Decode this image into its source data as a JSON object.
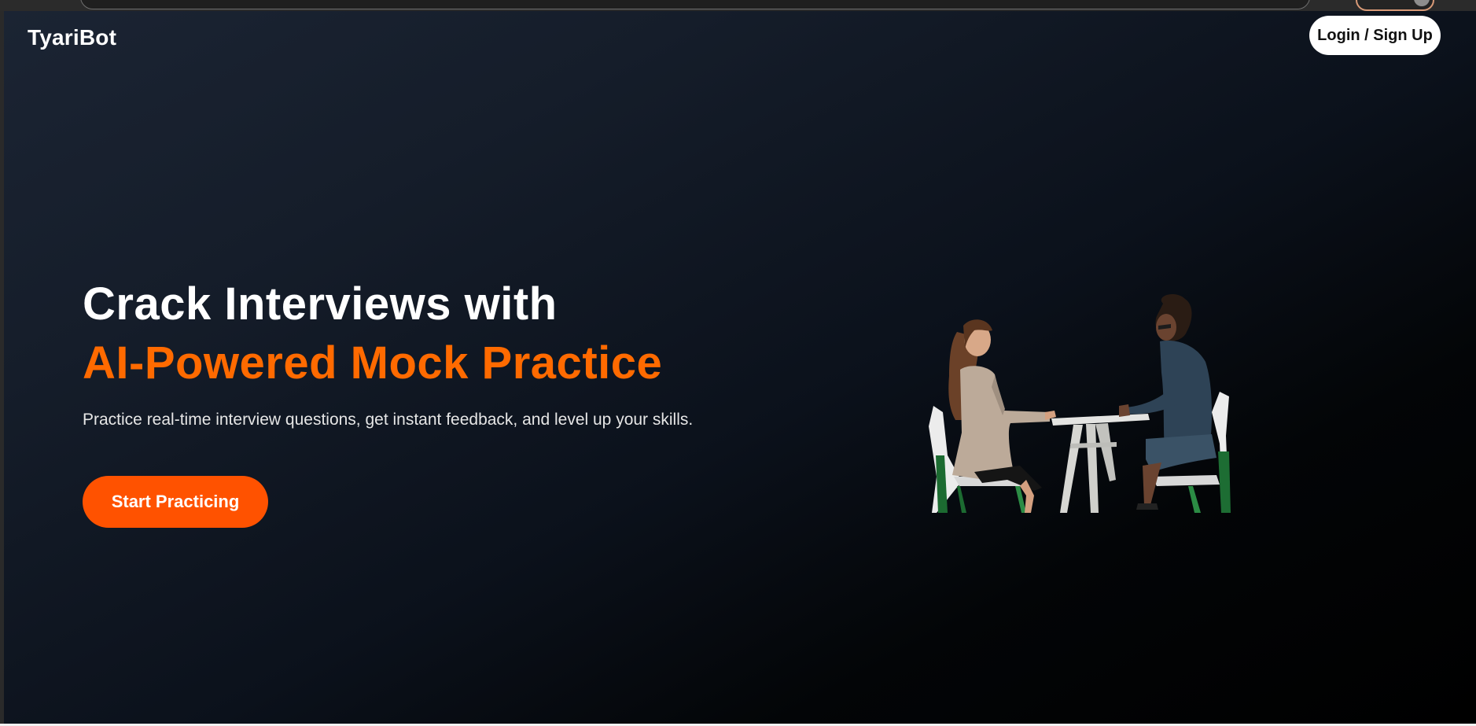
{
  "brand": {
    "name": "TyariBot"
  },
  "nav": {
    "login_label": "Login / Sign Up"
  },
  "hero": {
    "headline_line1": "Crack Interviews with",
    "headline_line2": "AI-Powered Mock Practice",
    "subtitle": "Practice real-time interview questions, get instant feedback, and level up your skills.",
    "cta_label": "Start Practicing",
    "illustration": "two-people-interview-at-table"
  },
  "colors": {
    "accent": "#ff6a00",
    "cta_bg": "#ff5200",
    "background_start": "#1b2433",
    "background_end": "#000000",
    "text": "#ffffff"
  }
}
